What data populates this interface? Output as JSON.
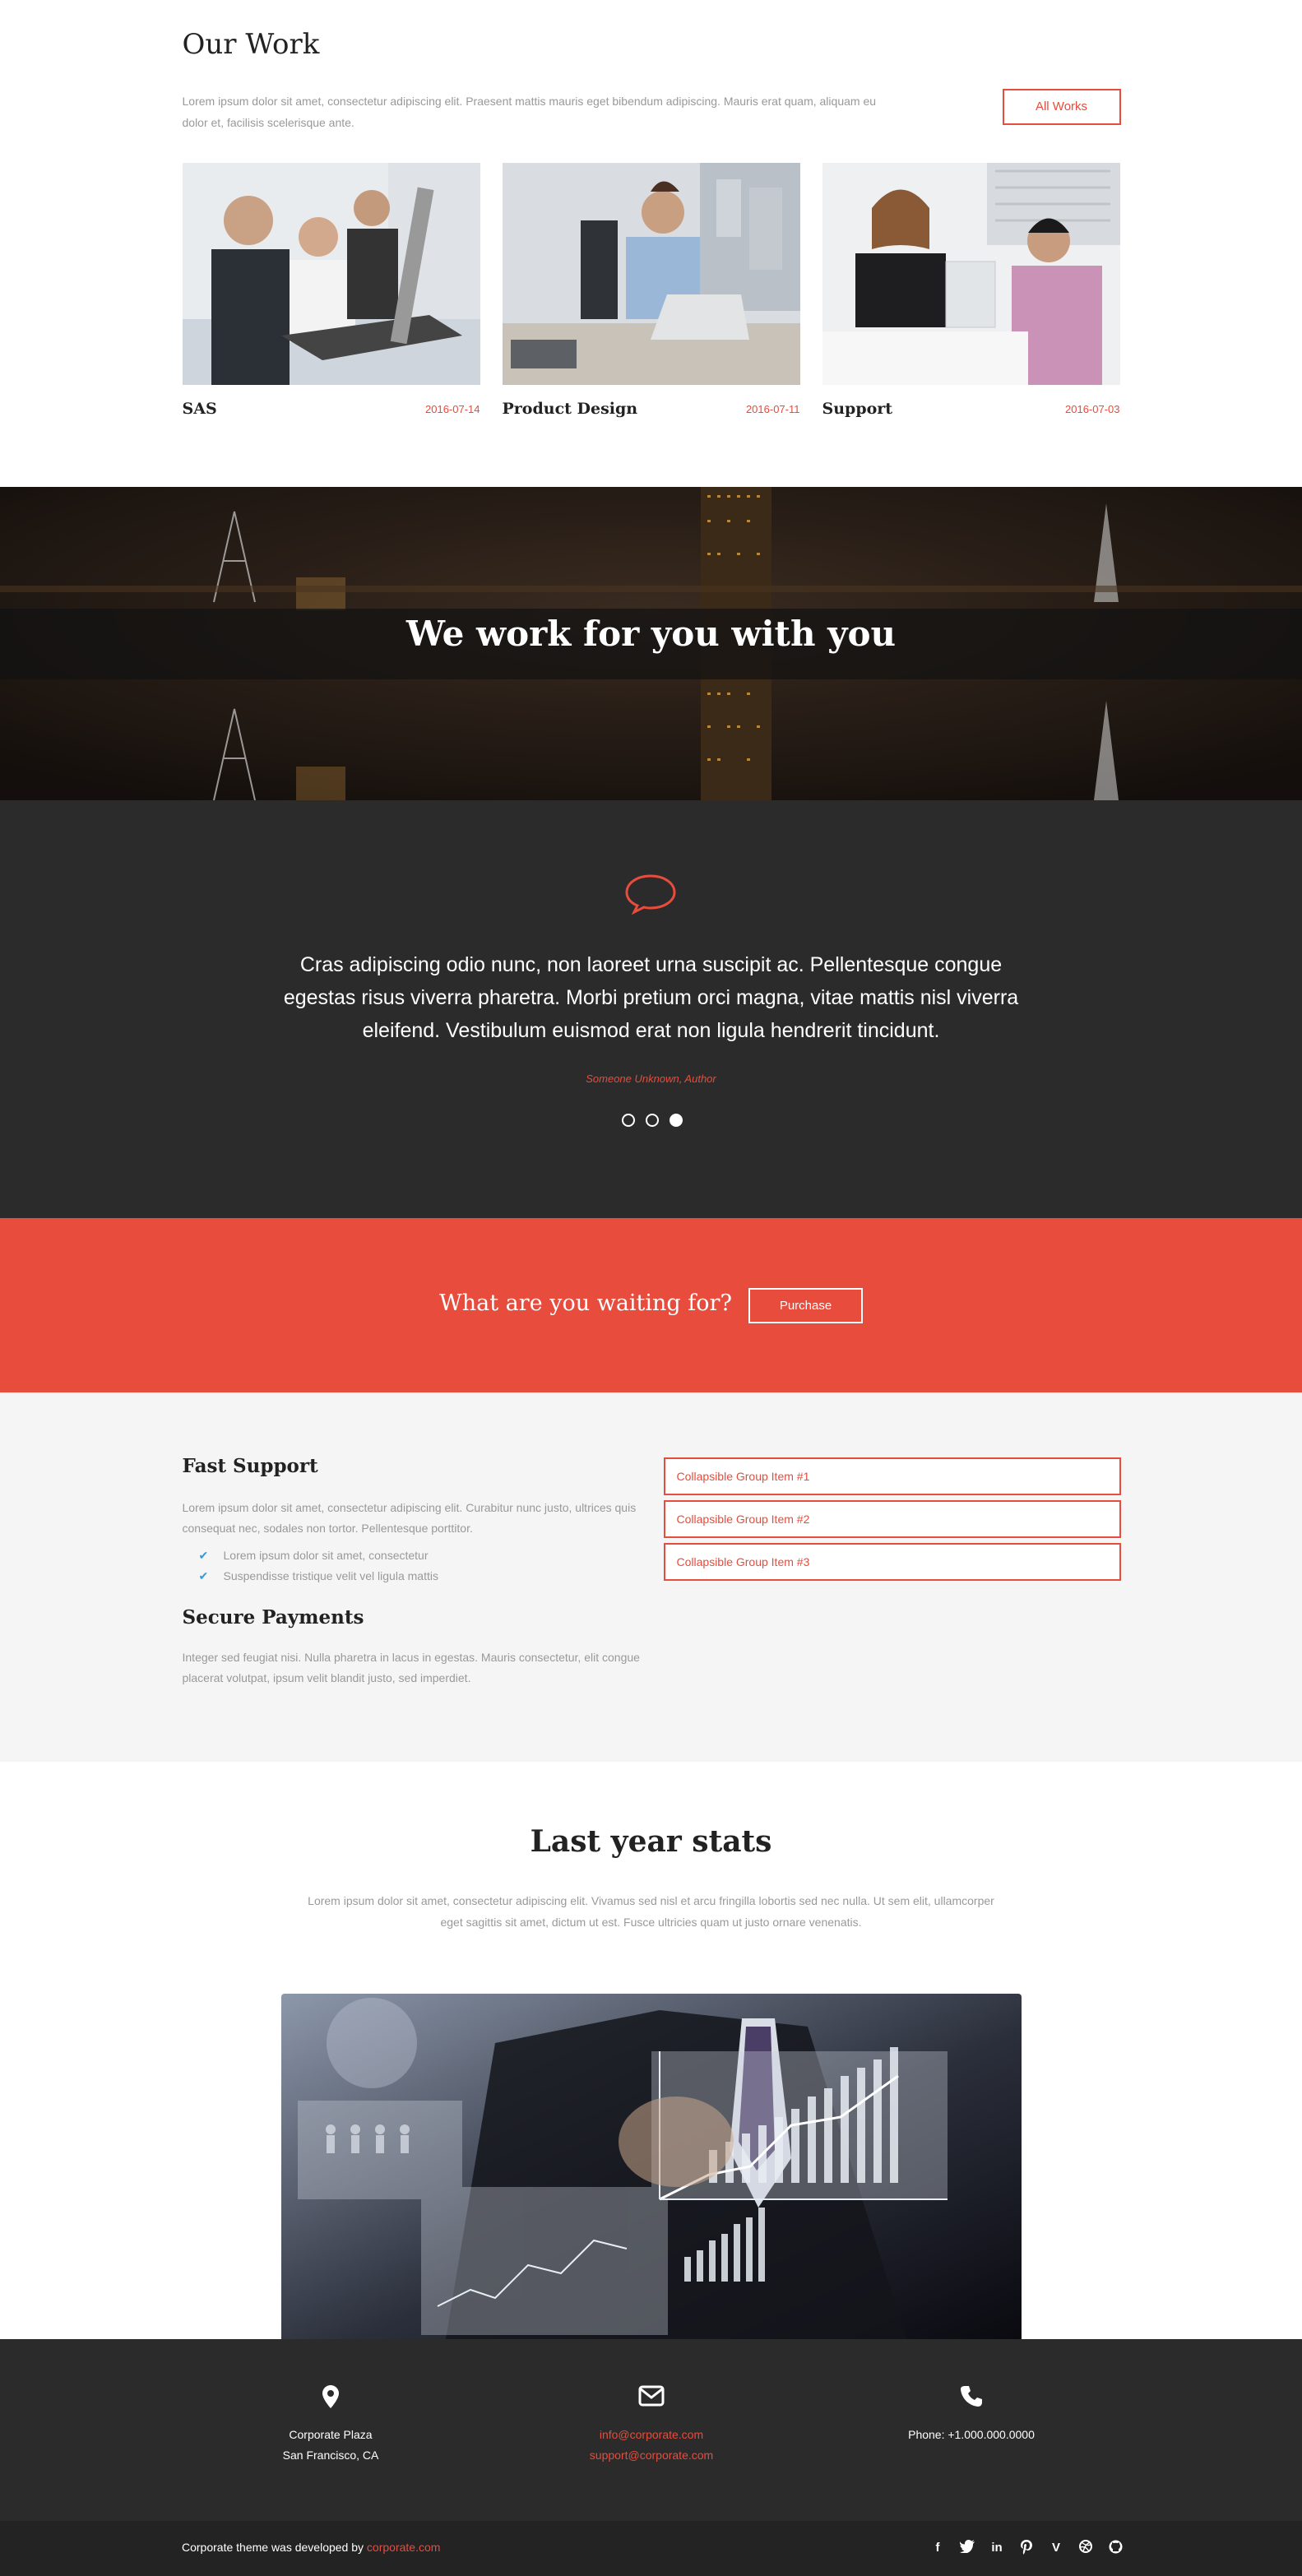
{
  "our_work": {
    "title": "Our Work",
    "intro": "Lorem ipsum dolor sit amet, consectetur adipiscing elit. Praesent mattis mauris eget bibendum adipiscing. Mauris erat quam, aliquam eu dolor et, facilisis scelerisque ante.",
    "all_works_label": "All Works",
    "items": [
      {
        "name": "SAS",
        "date": "2016-07-14"
      },
      {
        "name": "Product Design",
        "date": "2016-07-11"
      },
      {
        "name": "Support",
        "date": "2016-07-03"
      }
    ]
  },
  "banner": {
    "headline": "We work for you with you"
  },
  "testimonial": {
    "quote": "Cras adipiscing odio nunc, non laoreet urna suscipit ac. Pellentesque congue egestas risus viverra pharetra. Morbi pretium orci magna, vitae mattis nisl viverra eleifend. Vestibulum euismod erat non ligula hendrerit tincidunt.",
    "author": "Someone Unknown, Author",
    "active_slide": 3
  },
  "cta": {
    "text": "What are you waiting for?",
    "button_label": "Purchase"
  },
  "features": {
    "fast_support": {
      "title": "Fast Support",
      "text": "Lorem ipsum dolor sit amet, consectetur adipiscing elit. Curabitur nunc justo, ultrices quis consequat nec, sodales non tortor. Pellentesque porttitor.",
      "list": [
        "Lorem ipsum dolor sit amet, consectetur",
        "Suspendisse tristique velit vel ligula mattis"
      ]
    },
    "secure_payments": {
      "title": "Secure Payments",
      "text": "Integer sed feugiat nisi. Nulla pharetra in lacus in egestas. Mauris consectetur, elit congue placerat volutpat, ipsum velit blandit justo, sed imperdiet."
    },
    "collapsible": [
      "Collapsible Group Item #1",
      "Collapsible Group Item #2",
      "Collapsible Group Item #3"
    ]
  },
  "stats": {
    "title": "Last year stats",
    "intro": "Lorem ipsum dolor sit amet, consectetur adipiscing elit. Vivamus sed nisl et arcu fringilla lobortis sed nec nulla. Ut sem elit, ullamcorper eget sagittis sit amet, dictum ut est. Fusce ultricies quam ut justo ornare venenatis."
  },
  "contact": {
    "address_line1": "Corporate Plaza",
    "address_line2": "San Francisco, CA",
    "email1": "info@corporate.com",
    "email2": "support@corporate.com",
    "phone": "Phone: +1.000.000.0000"
  },
  "footer": {
    "credit_text": "Corporate theme was developed by ",
    "credit_link": "corporate.com",
    "socials": [
      "facebook-icon",
      "twitter-icon",
      "linkedin-icon",
      "pinterest-icon",
      "vimeo-icon",
      "dribbble-icon",
      "github-icon"
    ]
  },
  "colors": {
    "accent": "#e74c3c",
    "dark": "#2b2b2b",
    "check": "#3498db"
  }
}
